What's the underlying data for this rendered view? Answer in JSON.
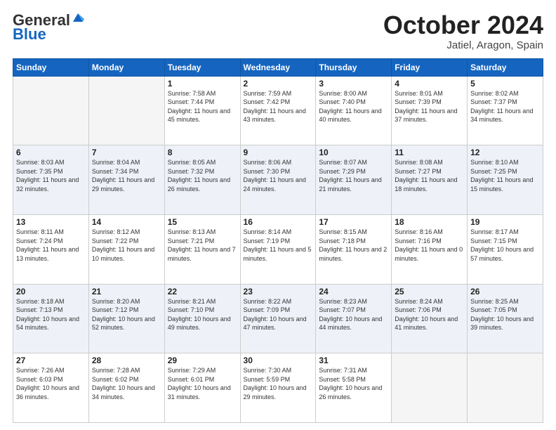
{
  "header": {
    "logo_line1": "General",
    "logo_line2": "Blue",
    "month": "October 2024",
    "location": "Jatiel, Aragon, Spain"
  },
  "weekdays": [
    "Sunday",
    "Monday",
    "Tuesday",
    "Wednesday",
    "Thursday",
    "Friday",
    "Saturday"
  ],
  "weeks": [
    [
      {
        "day": "",
        "info": ""
      },
      {
        "day": "",
        "info": ""
      },
      {
        "day": "1",
        "info": "Sunrise: 7:58 AM\nSunset: 7:44 PM\nDaylight: 11 hours and 45 minutes."
      },
      {
        "day": "2",
        "info": "Sunrise: 7:59 AM\nSunset: 7:42 PM\nDaylight: 11 hours and 43 minutes."
      },
      {
        "day": "3",
        "info": "Sunrise: 8:00 AM\nSunset: 7:40 PM\nDaylight: 11 hours and 40 minutes."
      },
      {
        "day": "4",
        "info": "Sunrise: 8:01 AM\nSunset: 7:39 PM\nDaylight: 11 hours and 37 minutes."
      },
      {
        "day": "5",
        "info": "Sunrise: 8:02 AM\nSunset: 7:37 PM\nDaylight: 11 hours and 34 minutes."
      }
    ],
    [
      {
        "day": "6",
        "info": "Sunrise: 8:03 AM\nSunset: 7:35 PM\nDaylight: 11 hours and 32 minutes."
      },
      {
        "day": "7",
        "info": "Sunrise: 8:04 AM\nSunset: 7:34 PM\nDaylight: 11 hours and 29 minutes."
      },
      {
        "day": "8",
        "info": "Sunrise: 8:05 AM\nSunset: 7:32 PM\nDaylight: 11 hours and 26 minutes."
      },
      {
        "day": "9",
        "info": "Sunrise: 8:06 AM\nSunset: 7:30 PM\nDaylight: 11 hours and 24 minutes."
      },
      {
        "day": "10",
        "info": "Sunrise: 8:07 AM\nSunset: 7:29 PM\nDaylight: 11 hours and 21 minutes."
      },
      {
        "day": "11",
        "info": "Sunrise: 8:08 AM\nSunset: 7:27 PM\nDaylight: 11 hours and 18 minutes."
      },
      {
        "day": "12",
        "info": "Sunrise: 8:10 AM\nSunset: 7:25 PM\nDaylight: 11 hours and 15 minutes."
      }
    ],
    [
      {
        "day": "13",
        "info": "Sunrise: 8:11 AM\nSunset: 7:24 PM\nDaylight: 11 hours and 13 minutes."
      },
      {
        "day": "14",
        "info": "Sunrise: 8:12 AM\nSunset: 7:22 PM\nDaylight: 11 hours and 10 minutes."
      },
      {
        "day": "15",
        "info": "Sunrise: 8:13 AM\nSunset: 7:21 PM\nDaylight: 11 hours and 7 minutes."
      },
      {
        "day": "16",
        "info": "Sunrise: 8:14 AM\nSunset: 7:19 PM\nDaylight: 11 hours and 5 minutes."
      },
      {
        "day": "17",
        "info": "Sunrise: 8:15 AM\nSunset: 7:18 PM\nDaylight: 11 hours and 2 minutes."
      },
      {
        "day": "18",
        "info": "Sunrise: 8:16 AM\nSunset: 7:16 PM\nDaylight: 11 hours and 0 minutes."
      },
      {
        "day": "19",
        "info": "Sunrise: 8:17 AM\nSunset: 7:15 PM\nDaylight: 10 hours and 57 minutes."
      }
    ],
    [
      {
        "day": "20",
        "info": "Sunrise: 8:18 AM\nSunset: 7:13 PM\nDaylight: 10 hours and 54 minutes."
      },
      {
        "day": "21",
        "info": "Sunrise: 8:20 AM\nSunset: 7:12 PM\nDaylight: 10 hours and 52 minutes."
      },
      {
        "day": "22",
        "info": "Sunrise: 8:21 AM\nSunset: 7:10 PM\nDaylight: 10 hours and 49 minutes."
      },
      {
        "day": "23",
        "info": "Sunrise: 8:22 AM\nSunset: 7:09 PM\nDaylight: 10 hours and 47 minutes."
      },
      {
        "day": "24",
        "info": "Sunrise: 8:23 AM\nSunset: 7:07 PM\nDaylight: 10 hours and 44 minutes."
      },
      {
        "day": "25",
        "info": "Sunrise: 8:24 AM\nSunset: 7:06 PM\nDaylight: 10 hours and 41 minutes."
      },
      {
        "day": "26",
        "info": "Sunrise: 8:25 AM\nSunset: 7:05 PM\nDaylight: 10 hours and 39 minutes."
      }
    ],
    [
      {
        "day": "27",
        "info": "Sunrise: 7:26 AM\nSunset: 6:03 PM\nDaylight: 10 hours and 36 minutes."
      },
      {
        "day": "28",
        "info": "Sunrise: 7:28 AM\nSunset: 6:02 PM\nDaylight: 10 hours and 34 minutes."
      },
      {
        "day": "29",
        "info": "Sunrise: 7:29 AM\nSunset: 6:01 PM\nDaylight: 10 hours and 31 minutes."
      },
      {
        "day": "30",
        "info": "Sunrise: 7:30 AM\nSunset: 5:59 PM\nDaylight: 10 hours and 29 minutes."
      },
      {
        "day": "31",
        "info": "Sunrise: 7:31 AM\nSunset: 5:58 PM\nDaylight: 10 hours and 26 minutes."
      },
      {
        "day": "",
        "info": ""
      },
      {
        "day": "",
        "info": ""
      }
    ]
  ]
}
